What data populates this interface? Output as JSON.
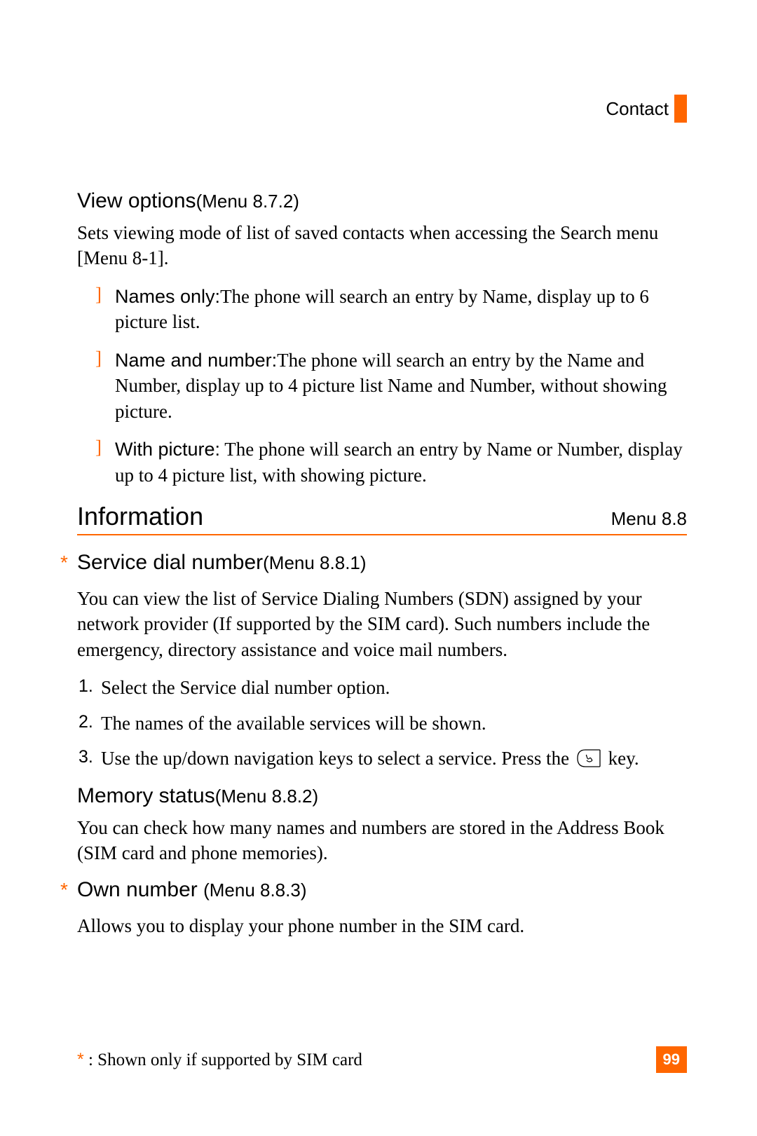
{
  "header": {
    "label": "Contact"
  },
  "view_options": {
    "title": "View options",
    "menu_ref": "(Menu 8.7.2)",
    "intro": "Sets viewing mode of list of saved contacts when accessing the Search menu [Menu 8-1].",
    "items": [
      {
        "label": "Names only:",
        "text": "The phone will search an entry by Name, display up to 6 picture list."
      },
      {
        "label": "Name and number:",
        "text": "The phone will search an entry by the Name and Number, display up to 4 picture list Name and Number, without showing picture."
      },
      {
        "label": "With picture:",
        "text": "  The phone will search an entry by Name or Number, display up to 4 picture list, with showing picture."
      }
    ]
  },
  "information": {
    "title": "Information",
    "menu_ref": "Menu 8.8",
    "sdn": {
      "title": "Service dial number",
      "menu_ref": "(Menu 8.8.1)",
      "intro": "You can view the list of Service Dialing Numbers (SDN) assigned by your network provider (If supported by the SIM card). Such numbers include the emergency, directory assistance and voice mail numbers.",
      "steps": [
        "Select the Service dial number option.",
        "The names of the available services will be shown.",
        {
          "pre": "Use the up/down navigation keys to select a service. Press the ",
          "post": " key."
        }
      ]
    },
    "memory": {
      "title": "Memory status",
      "menu_ref": "(Menu 8.8.2)",
      "text": "You can check how many names and numbers are stored in the Address Book (SIM card and phone memories)."
    },
    "own": {
      "title": "Own number ",
      "menu_ref": "(Menu 8.8.3)",
      "text": "Allows you to display your phone number in the SIM card."
    }
  },
  "footnote": {
    "star": "*",
    "text": " : Shown only if supported by SIM card"
  },
  "page_number": "99"
}
